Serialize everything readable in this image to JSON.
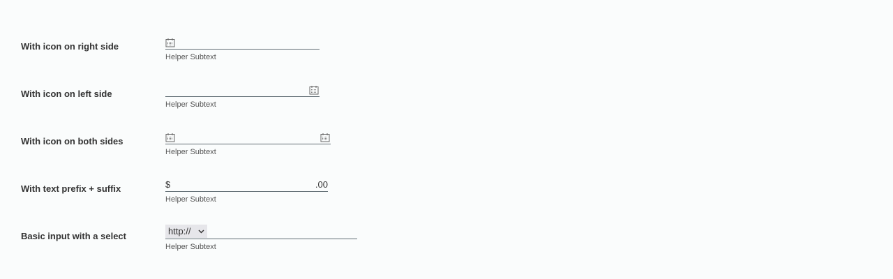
{
  "rows": [
    {
      "label": "With icon on right side",
      "helper": "Helper Subtext",
      "icon_left": "calendar-icon"
    },
    {
      "label": "With icon on left side",
      "helper": "Helper Subtext",
      "icon_right": "calendar-icon"
    },
    {
      "label": "With icon on both sides",
      "helper": "Helper Subtext",
      "icon_left": "calendar-icon",
      "icon_right": "calendar-icon"
    },
    {
      "label": "With text prefix + suffix",
      "helper": "Helper Subtext",
      "prefix": "$",
      "suffix": ".00"
    },
    {
      "label": "Basic input with a select",
      "helper": "Helper Subtext",
      "select_value": "http://"
    }
  ]
}
